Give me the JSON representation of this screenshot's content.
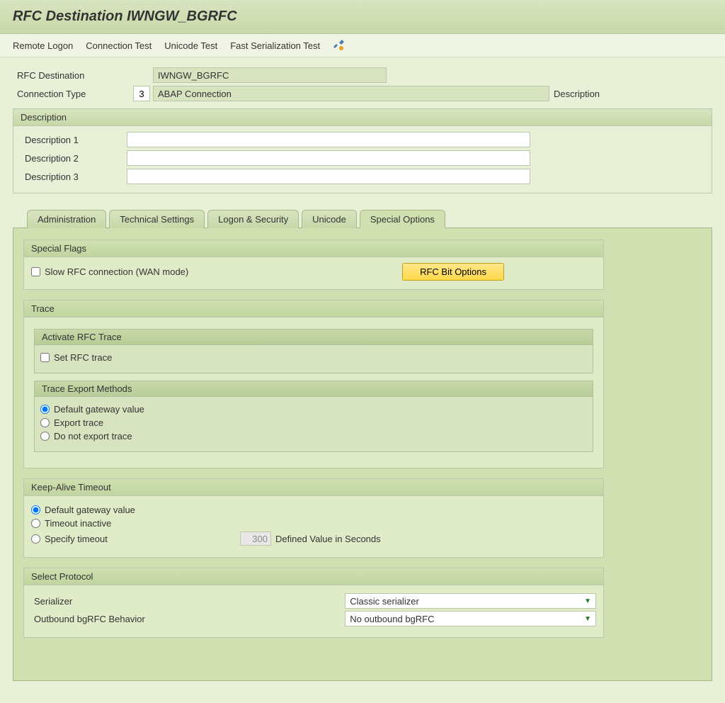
{
  "header": {
    "title": "RFC Destination IWNGW_BGRFC"
  },
  "toolbar": {
    "remote_logon": "Remote Logon",
    "connection_test": "Connection Test",
    "unicode_test": "Unicode Test",
    "fast_serialization_test": "Fast Serialization Test"
  },
  "fields": {
    "rfc_destination_label": "RFC Destination",
    "rfc_destination_value": "IWNGW_BGRFC",
    "connection_type_label": "Connection Type",
    "connection_type_code": "3",
    "connection_type_value": "ABAP Connection",
    "description_label": "Description"
  },
  "description": {
    "panel_title": "Description",
    "d1_label": "Description 1",
    "d1_value": "",
    "d2_label": "Description 2",
    "d2_value": "",
    "d3_label": "Description 3",
    "d3_value": ""
  },
  "tabs": {
    "administration": "Administration",
    "technical_settings": "Technical Settings",
    "logon_security": "Logon & Security",
    "unicode": "Unicode",
    "special_options": "Special Options"
  },
  "special_flags": {
    "title": "Special Flags",
    "slow_rfc": "Slow RFC connection (WAN mode)",
    "rfc_bit_options": "RFC Bit Options"
  },
  "trace": {
    "title": "Trace",
    "activate_title": "Activate RFC Trace",
    "set_rfc_trace": "Set RFC trace",
    "export_title": "Trace Export Methods",
    "default_gateway": "Default gateway value",
    "export_trace": "Export trace",
    "do_not_export": "Do not export trace"
  },
  "keepalive": {
    "title": "Keep-Alive Timeout",
    "default_gateway": "Default gateway value",
    "timeout_inactive": "Timeout inactive",
    "specify_timeout": "Specify timeout",
    "timeout_value": "300",
    "defined_label": "Defined Value in Seconds"
  },
  "protocol": {
    "title": "Select Protocol",
    "serializer_label": "Serializer",
    "serializer_value": "Classic serializer",
    "outbound_label": "Outbound bgRFC Behavior",
    "outbound_value": "No outbound bgRFC"
  }
}
